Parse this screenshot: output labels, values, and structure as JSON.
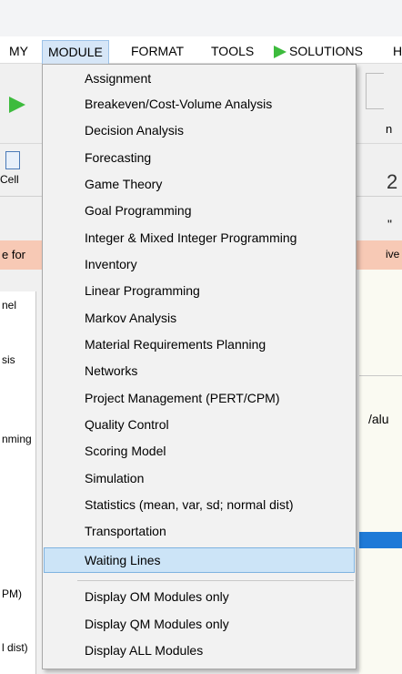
{
  "menubar": {
    "items": [
      {
        "label": "MY",
        "open": false
      },
      {
        "label": "MODULE",
        "open": true
      },
      {
        "label": "FORMAT",
        "open": false
      },
      {
        "label": "TOOLS",
        "open": false
      },
      {
        "label": "SOLUTIONS",
        "open": false
      },
      {
        "label": "H",
        "open": false
      }
    ]
  },
  "background": {
    "cell_label": "Cell",
    "big_number": "2",
    "pink_left": "e for",
    "pink_right": "ive",
    "panel_text": [
      "nel",
      "sis",
      "nming",
      "PM)",
      "l dist)"
    ],
    "right_texts": [
      "n",
      "\"",
      "/alu"
    ]
  },
  "module_menu": {
    "items": [
      "Assignment",
      "Breakeven/Cost-Volume Analysis",
      "Decision Analysis",
      "Forecasting",
      "Game Theory",
      "Goal Programming",
      "Integer & Mixed Integer Programming",
      "Inventory",
      "Linear Programming",
      "Markov Analysis",
      "Material Requirements Planning",
      "Networks",
      "Project Management (PERT/CPM)",
      "Quality Control",
      "Scoring Model",
      "Simulation",
      "Statistics (mean, var, sd; normal dist)",
      "Transportation",
      "Waiting Lines"
    ],
    "highlighted": "Waiting Lines",
    "display_options": [
      "Display OM Modules only",
      "Display QM Modules only",
      "Display ALL Modules"
    ]
  },
  "colors": {
    "menu_highlight": "#cce4f7",
    "play_green": "#3dbb3d",
    "pink_bar": "#f7c9b5",
    "selection_blue": "#1e7ad7"
  }
}
